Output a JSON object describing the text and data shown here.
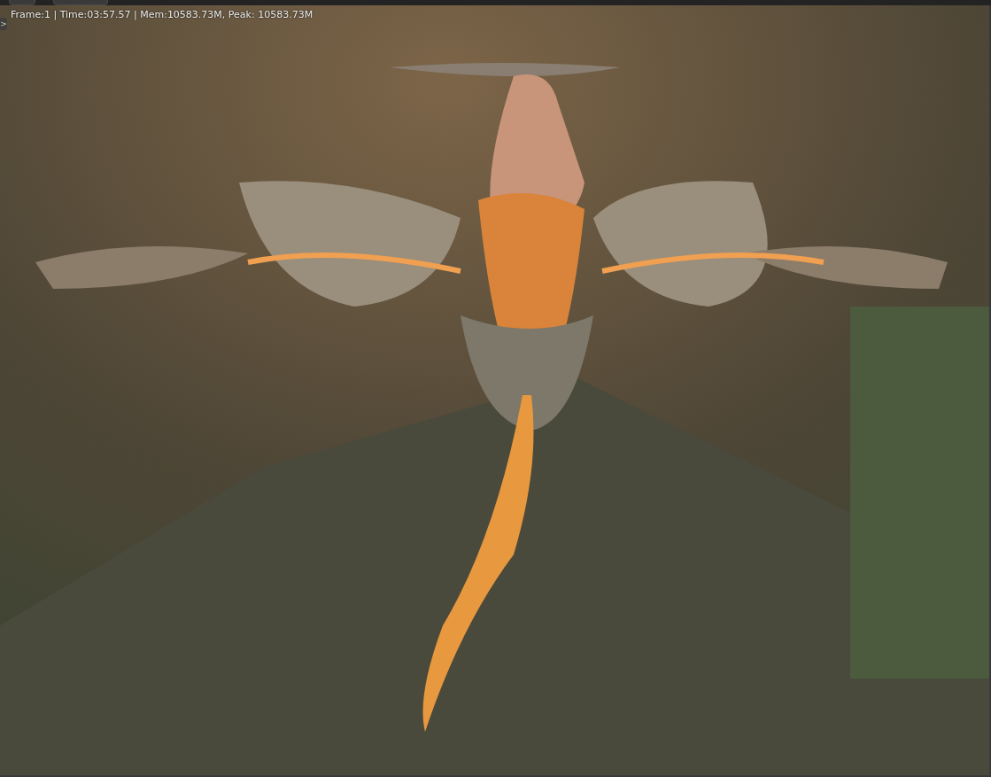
{
  "render_view": {
    "status": "Frame:1 | Time:03:57.57 | Mem:10583.73M, Peak: 10583.73M",
    "sidebar_toggle": ">"
  }
}
